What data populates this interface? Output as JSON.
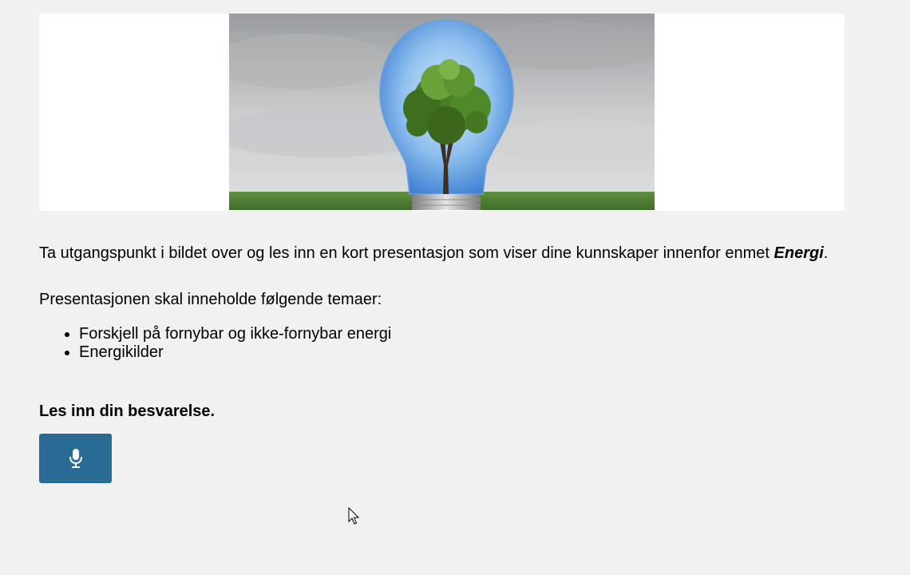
{
  "prompt": {
    "intro_text": "Ta utgangspunkt i bildet over og les inn en kort presentasjon som viser dine kunnskaper innenfor enmet ",
    "subject": "Energi",
    "intro_end": ".",
    "topics_intro": "Presentasjonen skal inneholde følgende temaer:",
    "topics": [
      "Forskjell på fornybar og ikke-fornybar energi",
      "Energikilder"
    ]
  },
  "answer": {
    "label": "Les inn din besvarelse.",
    "record_icon": "microphone-icon"
  },
  "colors": {
    "page_background": "#f1f1f1",
    "image_frame": "#ffffff",
    "button_background": "#2a6b96",
    "icon_color": "#ffffff"
  },
  "image": {
    "subject": "tree-inside-light-bulb",
    "icon": "lightbulb-tree-image"
  }
}
